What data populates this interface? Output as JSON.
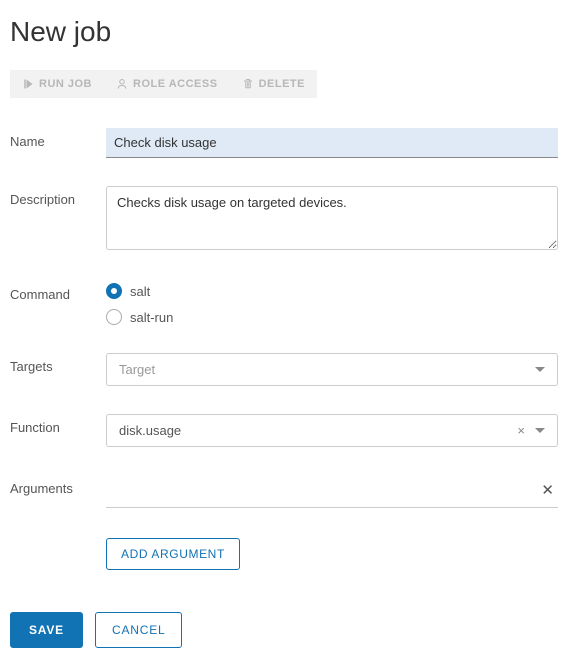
{
  "page": {
    "title": "New job"
  },
  "toolbar": {
    "run_job": "RUN JOB",
    "role_access": "ROLE ACCESS",
    "delete": "DELETE"
  },
  "labels": {
    "name": "Name",
    "description": "Description",
    "command": "Command",
    "targets": "Targets",
    "function": "Function",
    "arguments": "Arguments"
  },
  "fields": {
    "name_value": "Check disk usage",
    "description_value": "Checks disk usage on targeted devices.",
    "command_options": {
      "salt": "salt",
      "salt_run": "salt-run"
    },
    "command_selected": "salt",
    "targets_placeholder": "Target",
    "function_value": "disk.usage"
  },
  "buttons": {
    "add_argument": "ADD ARGUMENT",
    "save": "SAVE",
    "cancel": "CANCEL"
  },
  "colors": {
    "primary": "#1172b4",
    "highlight": "#dfeaf6",
    "border": "#cccccc",
    "disabled_bg": "#f2f2f2",
    "disabled_fg": "#b7b7b7"
  }
}
